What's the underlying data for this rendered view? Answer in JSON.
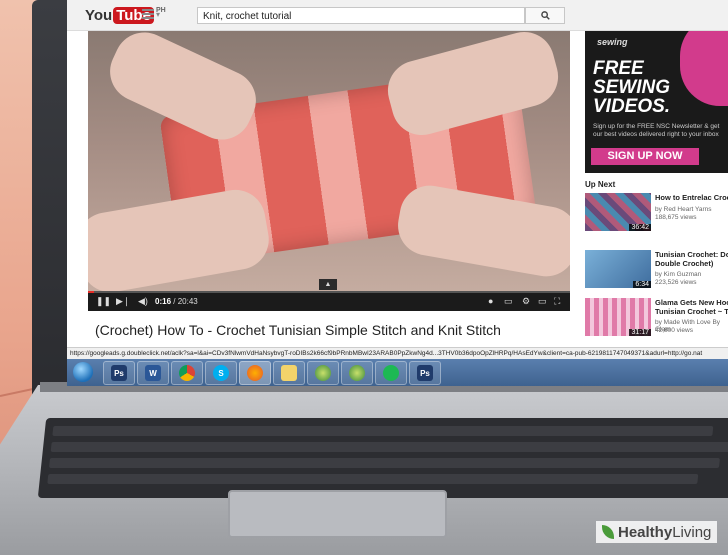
{
  "browser": {
    "logo_you": "You",
    "logo_tube": "Tube",
    "logo_region": "PH",
    "search_value": "Knit, crochet tutorial",
    "search_icon": "search-icon"
  },
  "player": {
    "current_time": "0:16",
    "duration": "/ 20:43",
    "progress_fraction": 0.013,
    "title": "(Crochet) How To - Crochet Tunisian Simple Stitch and Knit Stitch"
  },
  "ad": {
    "brand": "sewing",
    "headline_1": "FREE",
    "headline_2": "SEWING",
    "headline_3": "VIDEOS.",
    "copy": "Sign up for the FREE NSC Newsletter & get our best videos delivered right to your inbox",
    "cta": "SIGN UP NOW",
    "accent_color": "#d23b8c"
  },
  "up_next": {
    "label": "Up Next",
    "items": [
      {
        "title": "How to Entrelac Croc",
        "by": "by Red Heart Yarns",
        "views": "188,675 views",
        "duration": "36:42"
      },
      {
        "title": "Tunisian Crochet: Do Double Crochet)",
        "by": "by Kim Guzman",
        "views": "223,526 views",
        "duration": "6:34"
      },
      {
        "title": "Glama Gets New Hoo Tunisian Crochet ~ T",
        "by": "by Made With Love By Glam",
        "views": "42,800 views",
        "duration": "31:17"
      }
    ]
  },
  "status_bar": {
    "url": "https://googleads.g.doubleclick.net/aclk?sa=l&ai=CDv3fNlwmVdHaNsybvgT-roDIBs2k66cf9bPRnbMBwI23ARAB0PpZkwNg4d...3THV0b36dpoOpZlHRPq/HAsEdYw&client=ca-pub-6219811747049371&adurl=http://go.nat"
  },
  "taskbar": {
    "apps": [
      "windows-explorer",
      "photoshop",
      "word",
      "chrome",
      "skype",
      "firefox",
      "file-explorer",
      "app-green",
      "app-green-2",
      "spotify",
      "photoshop-2"
    ]
  },
  "watermark": {
    "brand_bold": "Healthy",
    "brand_normal": "Living"
  }
}
